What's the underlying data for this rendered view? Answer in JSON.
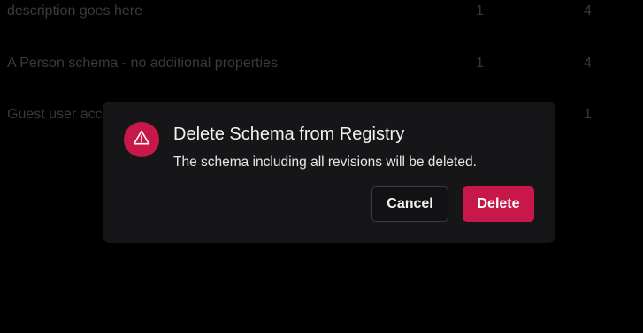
{
  "table": {
    "rows": [
      {
        "description": "description goes here",
        "col_a": "1",
        "col_b": "4"
      },
      {
        "description": "A Person schema - no additional properties",
        "col_a": "1",
        "col_b": "4"
      },
      {
        "description": "Guest user acc",
        "col_a": "",
        "col_b": "1"
      }
    ]
  },
  "dialog": {
    "icon": "warning-triangle-icon",
    "title": "Delete Schema from Registry",
    "message": "The schema including all revisions will be deleted.",
    "cancel_label": "Cancel",
    "delete_label": "Delete"
  },
  "colors": {
    "background": "#000000",
    "dialog_bg": "#161618",
    "danger": "#c8184a",
    "muted_text": "#3a3a3a"
  }
}
